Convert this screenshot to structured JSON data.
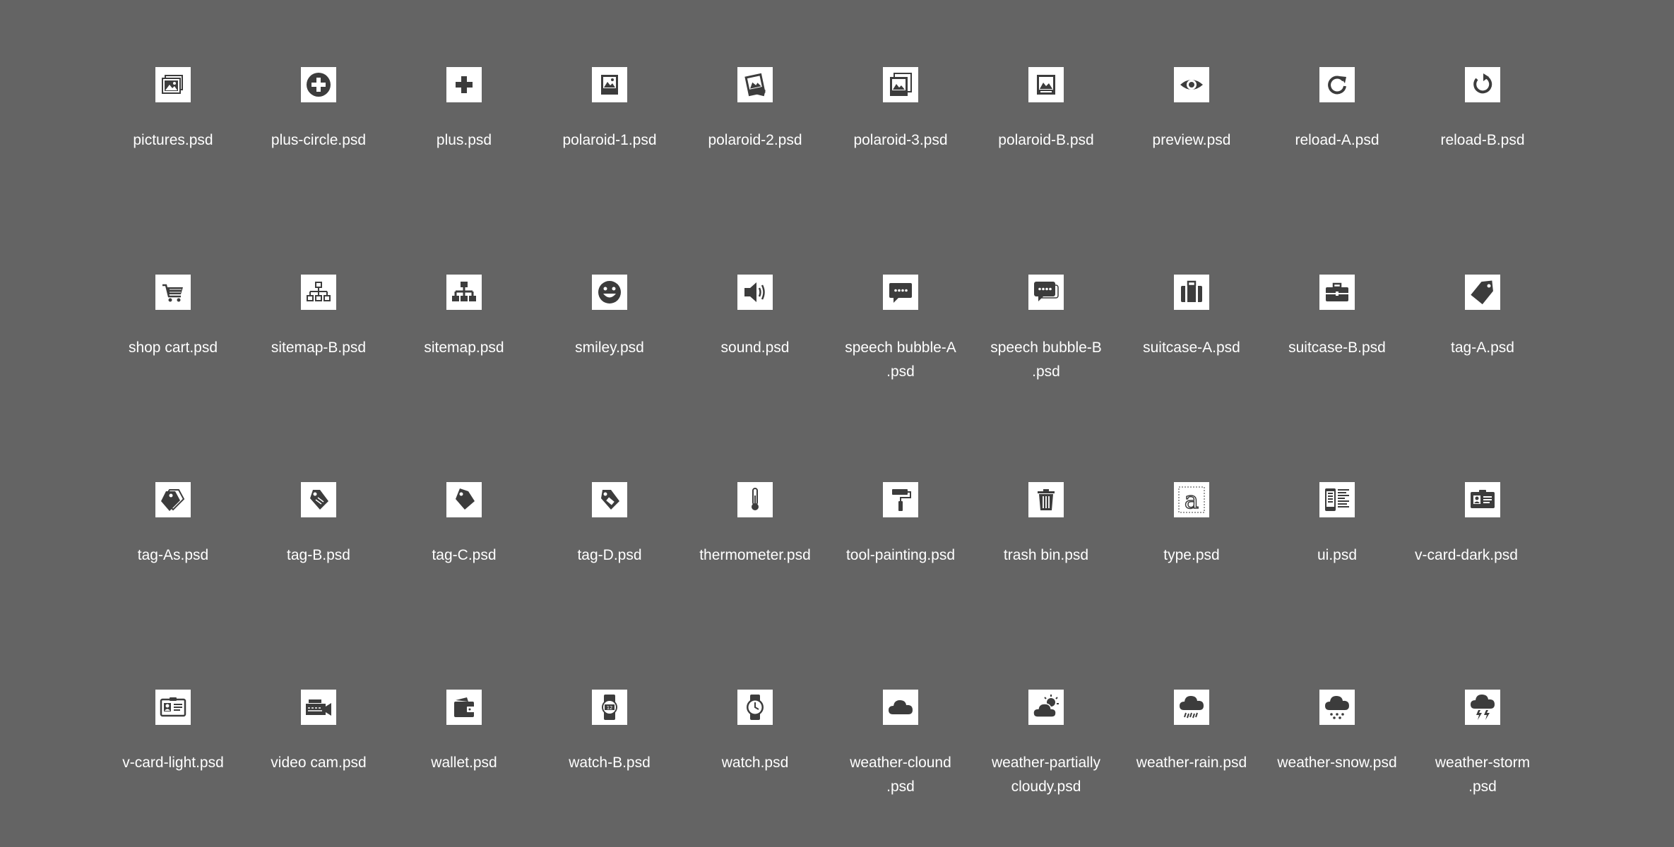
{
  "colors": {
    "background": "#646464",
    "tile": "#ffffff",
    "glyph": "#3c3c3c",
    "label": "#ffffff"
  },
  "files": [
    {
      "name": [
        "pictures.psd"
      ],
      "icon": "pictures-icon"
    },
    {
      "name": [
        "plus-circle.psd"
      ],
      "icon": "plus-circle-icon"
    },
    {
      "name": [
        "plus.psd"
      ],
      "icon": "plus-icon"
    },
    {
      "name": [
        "polaroid-1.psd"
      ],
      "icon": "polaroid-1-icon"
    },
    {
      "name": [
        "polaroid-2.psd"
      ],
      "icon": "polaroid-2-icon"
    },
    {
      "name": [
        "polaroid-3.psd"
      ],
      "icon": "polaroid-3-icon"
    },
    {
      "name": [
        "polaroid-B.psd"
      ],
      "icon": "polaroid-b-icon"
    },
    {
      "name": [
        "preview.psd"
      ],
      "icon": "preview-eye-icon"
    },
    {
      "name": [
        "reload-A.psd"
      ],
      "icon": "reload-a-icon"
    },
    {
      "name": [
        "reload-B.psd"
      ],
      "icon": "reload-b-icon"
    },
    {
      "name": [
        "shop cart.psd"
      ],
      "icon": "shop-cart-icon"
    },
    {
      "name": [
        "sitemap-B.psd"
      ],
      "icon": "sitemap-b-icon"
    },
    {
      "name": [
        "sitemap.psd"
      ],
      "icon": "sitemap-icon"
    },
    {
      "name": [
        "smiley.psd"
      ],
      "icon": "smiley-icon"
    },
    {
      "name": [
        "sound.psd"
      ],
      "icon": "sound-icon"
    },
    {
      "name": [
        "speech bubble-A",
        ".psd"
      ],
      "icon": "speech-bubble-a-icon"
    },
    {
      "name": [
        "speech bubble-B",
        ".psd"
      ],
      "icon": "speech-bubble-b-icon"
    },
    {
      "name": [
        "suitcase-A.psd"
      ],
      "icon": "suitcase-a-icon"
    },
    {
      "name": [
        "suitcase-B.psd"
      ],
      "icon": "suitcase-b-icon"
    },
    {
      "name": [
        "tag-A.psd"
      ],
      "icon": "tag-a-icon"
    },
    {
      "name": [
        "tag-As.psd"
      ],
      "icon": "tag-as-icon"
    },
    {
      "name": [
        "tag-B.psd"
      ],
      "icon": "tag-b-icon"
    },
    {
      "name": [
        "tag-C.psd"
      ],
      "icon": "tag-c-icon"
    },
    {
      "name": [
        "tag-D.psd"
      ],
      "icon": "tag-d-icon"
    },
    {
      "name": [
        "thermometer.psd"
      ],
      "icon": "thermometer-icon"
    },
    {
      "name": [
        "tool-painting.psd"
      ],
      "icon": "paint-roller-icon"
    },
    {
      "name": [
        "trash bin.psd"
      ],
      "icon": "trash-bin-icon"
    },
    {
      "name": [
        "type.psd"
      ],
      "icon": "type-icon"
    },
    {
      "name": [
        "ui.psd"
      ],
      "icon": "ui-icon"
    },
    {
      "name": [
        "v-card-dark.psd"
      ],
      "icon": "v-card-dark-icon",
      "clipped": true
    },
    {
      "name": [
        "v-card-light.psd"
      ],
      "icon": "v-card-light-icon"
    },
    {
      "name": [
        "video cam.psd"
      ],
      "icon": "video-cam-icon"
    },
    {
      "name": [
        "wallet.psd"
      ],
      "icon": "wallet-icon"
    },
    {
      "name": [
        "watch-B.psd"
      ],
      "icon": "watch-b-icon"
    },
    {
      "name": [
        "watch.psd"
      ],
      "icon": "watch-icon"
    },
    {
      "name": [
        "weather-clound",
        ".psd"
      ],
      "icon": "weather-cloud-icon"
    },
    {
      "name": [
        "weather-partially",
        "cloudy.psd"
      ],
      "icon": "weather-partly-cloudy-icon"
    },
    {
      "name": [
        "weather-rain.psd"
      ],
      "icon": "weather-rain-icon"
    },
    {
      "name": [
        "weather-snow.psd"
      ],
      "icon": "weather-snow-icon"
    },
    {
      "name": [
        "weather-storm",
        ".psd"
      ],
      "icon": "weather-storm-icon"
    }
  ]
}
